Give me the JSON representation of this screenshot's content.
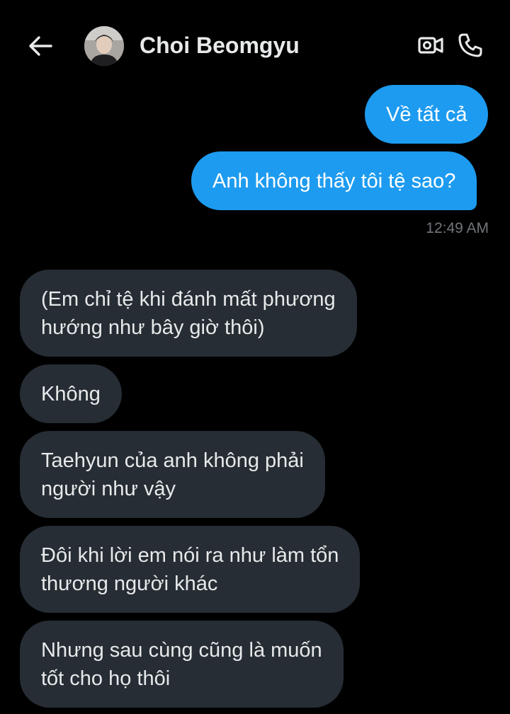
{
  "header": {
    "back_icon": "arrow-left-icon",
    "avatar_alt": "Choi Beomgyu avatar",
    "name": "Choi Beomgyu",
    "video_icon": "video-camera-icon",
    "call_icon": "phone-icon"
  },
  "colors": {
    "background": "#000000",
    "sent_bubble": "#1d9bf0",
    "received_bubble": "#262d34",
    "text_primary": "#e7e9ea",
    "timestamp": "#71767b"
  },
  "messages": {
    "sent": [
      {
        "text": "Về tất cả"
      },
      {
        "text": "Anh không thấy tôi tệ sao?"
      }
    ],
    "sent_timestamp": "12:49 AM",
    "received": [
      {
        "line1": "(Em chỉ tệ khi đánh mất phương",
        "line2": "hướng như bây giờ thôi)"
      },
      {
        "line1": "Không",
        "line2": ""
      },
      {
        "line1": "Taehyun của anh không phải",
        "line2": "người như vậy"
      },
      {
        "line1": "Đôi khi lời em nói ra như làm tổn",
        "line2": "thương người khác"
      },
      {
        "line1": "Nhưng sau cùng cũng là muốn",
        "line2": "tốt cho họ thôi"
      }
    ]
  }
}
